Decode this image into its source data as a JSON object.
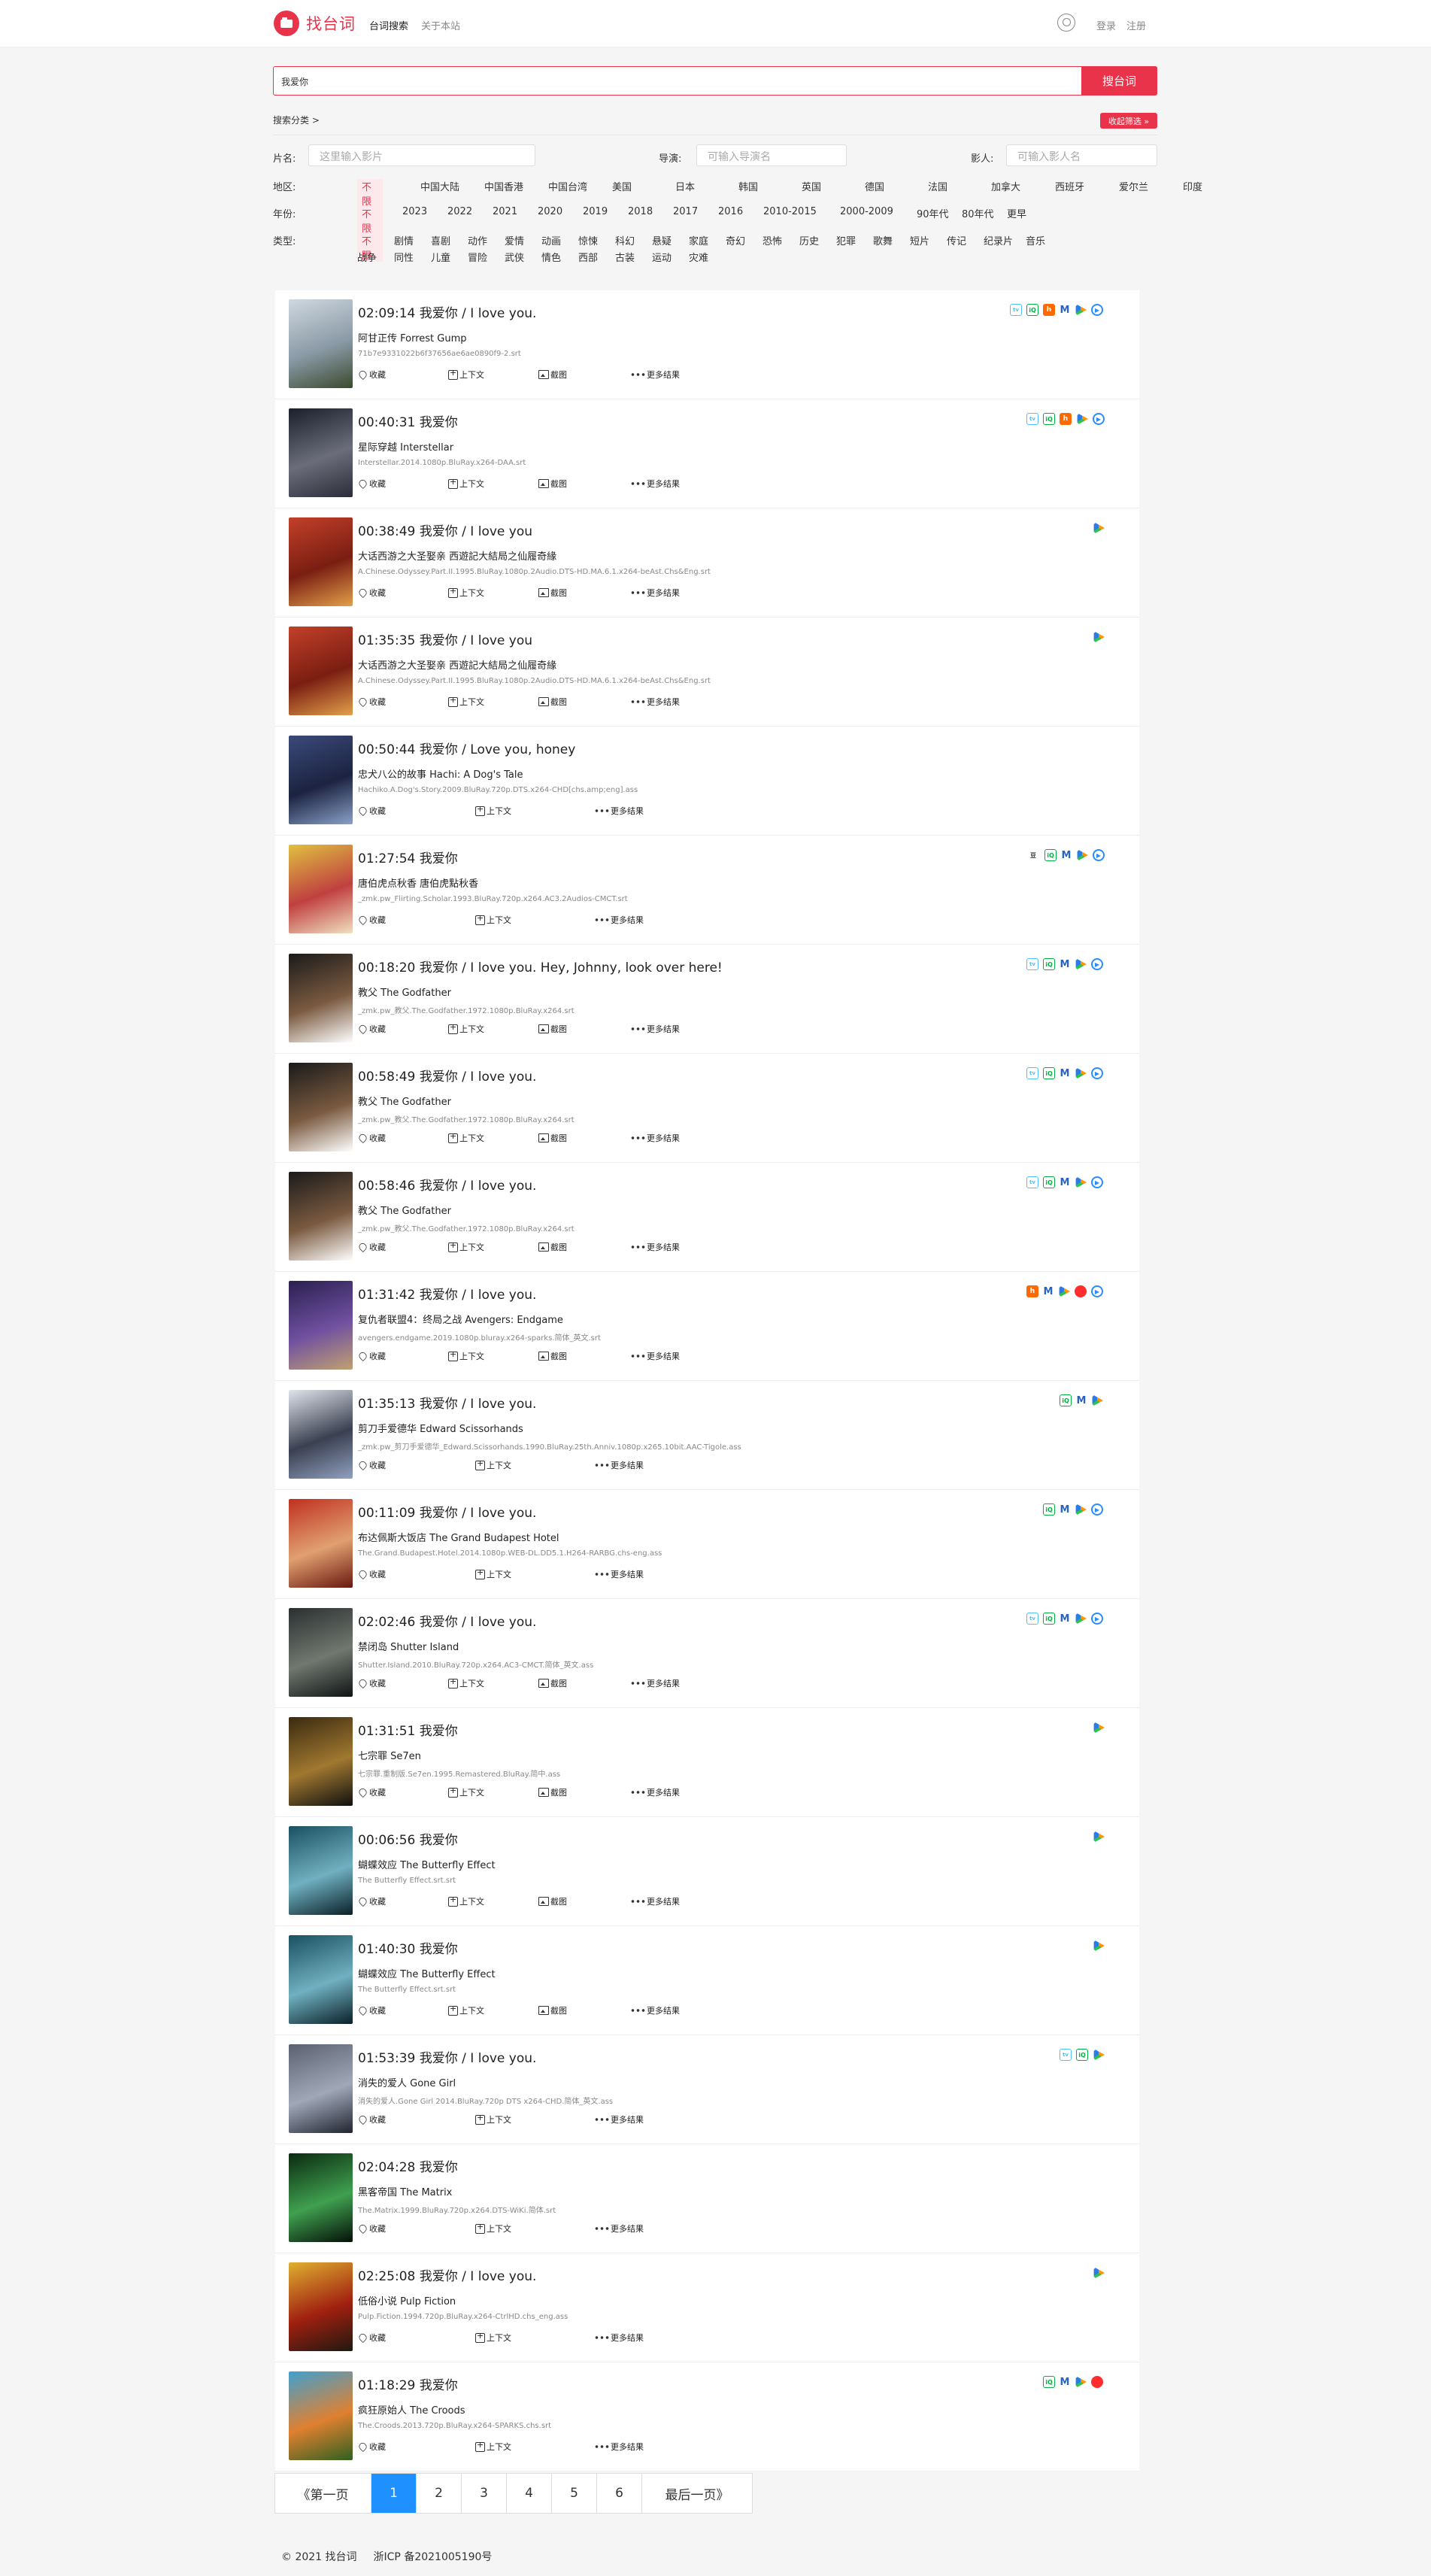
{
  "header": {
    "logo_text": "找台词",
    "nav": [
      "台词搜索",
      "关于本站"
    ],
    "login": "登录",
    "register": "注册"
  },
  "search": {
    "value": "我爱你",
    "button": "搜台词"
  },
  "filters": {
    "category_toggle": "搜索分类 >",
    "collapse": "收起筛选 »",
    "title_label": "片名:",
    "title_placeholder": "这里输入影片",
    "director_label": "导演:",
    "director_placeholder": "可输入导演名",
    "actor_label": "影人:",
    "actor_placeholder": "可输入影人名",
    "region_label": "地区:",
    "regions": [
      "不限",
      "中国大陆",
      "中国香港",
      "中国台湾",
      "美国",
      "日本",
      "韩国",
      "英国",
      "德国",
      "法国",
      "加拿大",
      "西班牙",
      "爱尔兰",
      "印度"
    ],
    "year_label": "年份:",
    "years": [
      "不限",
      "2023",
      "2022",
      "2021",
      "2020",
      "2019",
      "2018",
      "2017",
      "2016",
      "2010-2015",
      "2000-2009",
      "90年代",
      "80年代",
      "更早"
    ],
    "genre_label": "类型:",
    "genres_row1": [
      "不限",
      "剧情",
      "喜剧",
      "动作",
      "爱情",
      "动画",
      "惊悚",
      "科幻",
      "悬疑",
      "家庭",
      "奇幻",
      "恐怖",
      "历史",
      "犯罪",
      "歌舞",
      "短片",
      "传记",
      "纪录片",
      "音乐"
    ],
    "genres_row2": [
      "战争",
      "同性",
      "儿童",
      "冒险",
      "武侠",
      "情色",
      "西部",
      "古装",
      "运动",
      "灾难"
    ]
  },
  "actions": {
    "fav": "收藏",
    "ctx": "上下文",
    "shot": "截图",
    "more": "更多结果"
  },
  "results": [
    {
      "time": "02:09:14",
      "text": "我爱你 / I love you.",
      "movie": "阿甘正传 Forrest Gump",
      "file": "71b7e9331022b6f37656ae6ae0890f9-2.srt",
      "has_shot": true,
      "badges": [
        "bili",
        "iqy",
        "hu",
        "m",
        "tx",
        "yk"
      ],
      "poster": [
        "#cfd8e0",
        "#8a9aa6",
        "#3b4a2e"
      ]
    },
    {
      "time": "00:40:31",
      "text": "我爱你",
      "movie": "星际穿越 Interstellar",
      "file": "Interstellar.2014.1080p.BluRay.x264-DAA.srt",
      "has_shot": true,
      "badges": [
        "bili",
        "iqy",
        "hu",
        "tx",
        "yk"
      ],
      "poster": [
        "#1a1f2b",
        "#6b6d7a",
        "#2a2d38"
      ]
    },
    {
      "time": "00:38:49",
      "text": "我爱你 / I love you",
      "movie": "大话西游之大圣娶亲 西遊記大結局之仙履奇緣",
      "file": "A.Chinese.Odyssey.Part.II.1995.BluRay.1080p.2Audio.DTS-HD.MA.6.1.x264-beAst.Chs&Eng.srt",
      "has_shot": true,
      "badges": [
        "tx"
      ],
      "poster": [
        "#c2402a",
        "#7a1e12",
        "#e2a04a"
      ]
    },
    {
      "time": "01:35:35",
      "text": "我爱你 / I love you",
      "movie": "大话西游之大圣娶亲 西遊記大結局之仙履奇緣",
      "file": "A.Chinese.Odyssey.Part.II.1995.BluRay.1080p.2Audio.DTS-HD.MA.6.1.x264-beAst.Chs&Eng.srt",
      "has_shot": true,
      "badges": [
        "tx"
      ],
      "poster": [
        "#c2402a",
        "#7a1e12",
        "#e2a04a"
      ]
    },
    {
      "time": "00:50:44",
      "text": "我爱你 / Love you, honey",
      "movie": "忠犬八公的故事 Hachi: A Dog's Tale",
      "file": "Hachiko.A.Dog's.Story.2009.BluRay.720p.DTS.x264-CHD[chs.amp;eng].ass",
      "has_shot": false,
      "badges": [],
      "poster": [
        "#3b4a7a",
        "#1c2340",
        "#8aa0c8"
      ]
    },
    {
      "time": "01:27:54",
      "text": "我爱你",
      "movie": "唐伯虎点秋香 唐伯虎點秋香",
      "file": "_zmk.pw_Flirting.Scholar.1993.BluRay.720p.x264.AC3.2Audios-CMCT.srt",
      "has_shot": false,
      "badges": [
        "dou",
        "iqy",
        "m",
        "tx",
        "yk"
      ],
      "poster": [
        "#e0c040",
        "#c04040",
        "#f0e0c0"
      ]
    },
    {
      "time": "00:18:20",
      "text": "我爱你 / I love you. Hey, Johnny, look over here!",
      "movie": "教父 The Godfather",
      "file": "_zmk.pw_教父.The.Godfather.1972.1080p.BluRay.x264.srt",
      "has_shot": true,
      "badges": [
        "bili",
        "iqy",
        "m",
        "tx",
        "yk"
      ],
      "poster": [
        "#1a1a1a",
        "#7a5a40",
        "#ffffff"
      ]
    },
    {
      "time": "00:58:49",
      "text": "我爱你 / I love you.",
      "movie": "教父 The Godfather",
      "file": "_zmk.pw_教父.The.Godfather.1972.1080p.BluRay.x264.srt",
      "has_shot": true,
      "badges": [
        "bili",
        "iqy",
        "m",
        "tx",
        "yk"
      ],
      "poster": [
        "#1a1a1a",
        "#7a5a40",
        "#ffffff"
      ]
    },
    {
      "time": "00:58:46",
      "text": "我爱你 / I love you.",
      "movie": "教父 The Godfather",
      "file": "_zmk.pw_教父.The.Godfather.1972.1080p.BluRay.x264.srt",
      "has_shot": true,
      "badges": [
        "bili",
        "iqy",
        "m",
        "tx",
        "yk"
      ],
      "poster": [
        "#1a1a1a",
        "#7a5a40",
        "#ffffff"
      ]
    },
    {
      "time": "01:31:42",
      "text": "我爱你 / I love you.",
      "movie": "复仇者联盟4：终局之战 Avengers: Endgame",
      "file": "avengers.endgame.2019.1080p.bluray.x264-sparks.简体_英文.srt",
      "has_shot": true,
      "badges": [
        "hu",
        "m",
        "tx",
        "mg",
        "yk"
      ],
      "poster": [
        "#2a2050",
        "#7050a0",
        "#c0a070"
      ]
    },
    {
      "time": "01:35:13",
      "text": "我爱你 / I love you.",
      "movie": "剪刀手爱德华 Edward Scissorhands",
      "file": "_zmk.pw_剪刀手爱德华_Edward.Scissorhands.1990.BluRay.25th.Anniv.1080p.x265.10bit.AAC-Tigole.ass",
      "has_shot": false,
      "badges": [
        "iqy",
        "m",
        "tx"
      ],
      "poster": [
        "#e0e4ec",
        "#3a4050",
        "#90a0c0"
      ]
    },
    {
      "time": "00:11:09",
      "text": "我爱你 / I love you.",
      "movie": "布达佩斯大饭店 The Grand Budapest Hotel",
      "file": "The.Grand.Budapest.Hotel.2014.1080p.WEB-DL.DD5.1.H264-RARBG.chs-eng.ass",
      "has_shot": false,
      "badges": [
        "iqy",
        "m",
        "tx",
        "yk"
      ],
      "poster": [
        "#c03020",
        "#e0a070",
        "#6a1810"
      ]
    },
    {
      "time": "02:02:46",
      "text": "我爱你 / I love you.",
      "movie": "禁闭岛 Shutter Island",
      "file": "Shutter.Island.2010.BluRay.720p.x264.AC3-CMCT.简体_英文.ass",
      "has_shot": true,
      "badges": [
        "bili",
        "iqy",
        "m",
        "tx",
        "yk"
      ],
      "poster": [
        "#2a3030",
        "#707870",
        "#101414"
      ]
    },
    {
      "time": "01:31:51",
      "text": "我爱你",
      "movie": "七宗罪 Se7en",
      "file": "七宗罪.重制版.Se7en.1995.Remastered.BluRay.简中.ass",
      "has_shot": true,
      "badges": [
        "tx"
      ],
      "poster": [
        "#3a2a10",
        "#a07830",
        "#101010"
      ]
    },
    {
      "time": "00:06:56",
      "text": "我爱你",
      "movie": "蝴蝶效应 The Butterfly Effect",
      "file": "The Butterfly Effect.srt.srt",
      "has_shot": true,
      "badges": [
        "tx"
      ],
      "poster": [
        "#1a5060",
        "#70b0c0",
        "#0a2028"
      ]
    },
    {
      "time": "01:40:30",
      "text": "我爱你",
      "movie": "蝴蝶效应 The Butterfly Effect",
      "file": "The Butterfly Effect.srt.srt",
      "has_shot": true,
      "badges": [
        "tx"
      ],
      "poster": [
        "#1a5060",
        "#70b0c0",
        "#0a2028"
      ]
    },
    {
      "time": "01:53:39",
      "text": "我爱你 / I love you.",
      "movie": "消失的爱人 Gone Girl",
      "file": "消失的爱人.Gone Girl 2014.BluRay.720p DTS x264-CHD.简体_英文.ass",
      "has_shot": false,
      "badges": [
        "bili",
        "iqy",
        "tx"
      ],
      "poster": [
        "#5a6070",
        "#a0a8b8",
        "#202430"
      ]
    },
    {
      "time": "02:04:28",
      "text": "我爱你",
      "movie": "黑客帝国 The Matrix",
      "file": "The.Matrix.1999.BluRay.720p.x264.DTS-WiKi.简体.srt",
      "has_shot": false,
      "badges": [],
      "poster": [
        "#0a2a10",
        "#40a050",
        "#051008"
      ]
    },
    {
      "time": "02:25:08",
      "text": "我爱你 / I love you.",
      "movie": "低俗小说 Pulp Fiction",
      "file": "Pulp.Fiction.1994.720p.BluRay.x264-CtrlHD.chs_eng.ass",
      "has_shot": false,
      "badges": [
        "tx"
      ],
      "poster": [
        "#e0b030",
        "#a02010",
        "#201810"
      ]
    },
    {
      "time": "01:18:29",
      "text": "我爱你",
      "movie": "疯狂原始人 The Croods",
      "file": "The.Croods.2013.720p.BluRay.x264-SPARKS.chs.srt",
      "has_shot": false,
      "badges": [
        "iqy",
        "m",
        "tx",
        "mg"
      ],
      "poster": [
        "#40a0d0",
        "#e08030",
        "#306020"
      ]
    }
  ],
  "pagination": {
    "first": "《第一页",
    "pages": [
      "1",
      "2",
      "3",
      "4",
      "5",
      "6"
    ],
    "current": "1",
    "last": "最后一页》"
  },
  "footer": {
    "copyright": "© 2021 找台词",
    "icp": "浙ICP 备2021005190号"
  },
  "colors": {
    "accent": "#e8334a",
    "page_active": "#1e90ff"
  }
}
